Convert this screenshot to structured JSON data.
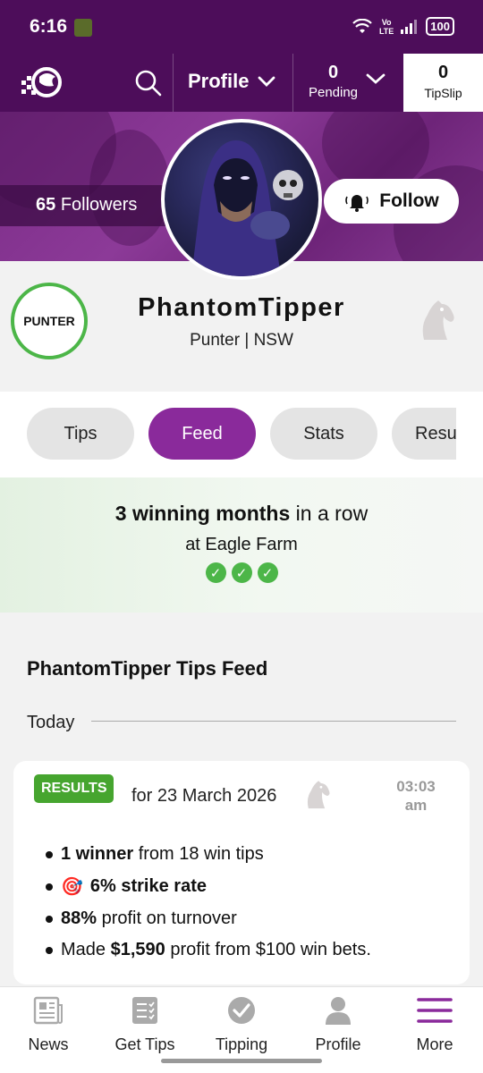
{
  "status_bar": {
    "time": "6:16",
    "network": "Vo\nLTE",
    "battery": "100"
  },
  "topnav": {
    "profile_label": "Profile",
    "pending_count": "0",
    "pending_label": "Pending",
    "tipslip_count": "0",
    "tipslip_label": "TipSlip"
  },
  "hero": {
    "followers_count": "65",
    "followers_label": "Followers",
    "follow_label": "Follow"
  },
  "profile": {
    "badge": "PUNTER",
    "username": "PhantomTipper",
    "subtitle": "Punter | NSW"
  },
  "tabs": [
    {
      "label": "Tips",
      "active": false
    },
    {
      "label": "Feed",
      "active": true
    },
    {
      "label": "Stats",
      "active": false
    },
    {
      "label": "Results",
      "active": false
    }
  ],
  "streak": {
    "bold": "3 winning months",
    "rest": " in a row",
    "venue": "at Eagle Farm",
    "checks": 3
  },
  "feed": {
    "title": "PhantomTipper Tips Feed",
    "day_label": "Today",
    "card": {
      "badge": "RESULTS",
      "date": "for 23 March 2026",
      "time_line1": "03:03",
      "time_line2": "am",
      "b1_bold": "1 winner",
      "b1_rest": " from 18 win tips",
      "b2_emoji": "🎯",
      "b2_bold": "6% strike rate",
      "b3_bold": "88%",
      "b3_rest": " profit on turnover",
      "b4_pre": "Made ",
      "b4_bold": "$1,590",
      "b4_rest": " profit from $100 win bets."
    }
  },
  "bottom_nav": [
    {
      "label": "News",
      "icon": "news-icon"
    },
    {
      "label": "Get Tips",
      "icon": "get-tips-icon"
    },
    {
      "label": "Tipping",
      "icon": "tipping-icon"
    },
    {
      "label": "Profile",
      "icon": "profile-icon"
    },
    {
      "label": "More",
      "icon": "more-icon"
    }
  ],
  "colors": {
    "brand": "#4d0d5a",
    "accent": "#8a2a9b",
    "success": "#46a52f"
  }
}
